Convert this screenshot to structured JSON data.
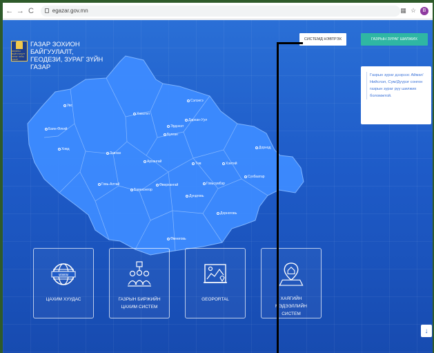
{
  "browser": {
    "back": "←",
    "forward": "→",
    "reload": "C",
    "url": "egazar.gov.mn",
    "profile_initial": "B"
  },
  "header": {
    "org_line1": "ГАЗАР ЗОХИОН БАЙГУУЛАЛТ,",
    "org_line2": "ГЕОДЕЗИ, ЗУРАГ ЗҮЙН ГАЗАР",
    "emblem_text": "ЗОХИОН БАЙГУУЛАЛТ ЗУРАГ ЗҮЙН ГАЗАР",
    "system_login": "СИСТЕМД НЭВТРЭХ",
    "plan_button": "ГАЗРЫН ЗУРАГ ШИЛЖИХ"
  },
  "side_card": {
    "text": "Газрын зураг дээрээс Аймаг/Нийслэл, Сум/Дүүрэг сонгон газрын зураг руу шилжих боломжтой."
  },
  "cities": [
    {
      "name": "Увс"
    },
    {
      "name": "Хөвсгөл"
    },
    {
      "name": "Сэлэнгэ"
    },
    {
      "name": "Баян-Өлгий"
    },
    {
      "name": "Эрдэнэт"
    },
    {
      "name": "Дархан-Уул"
    },
    {
      "name": "Булган"
    },
    {
      "name": "Ховд"
    },
    {
      "name": "Завхан"
    },
    {
      "name": "Архангай"
    },
    {
      "name": "Төв"
    },
    {
      "name": "Хэнтий"
    },
    {
      "name": "Дорнод"
    },
    {
      "name": "Говь-Алтай"
    },
    {
      "name": "Баянхонгор"
    },
    {
      "name": "Өвөрхангай"
    },
    {
      "name": "Сүхбаатар"
    },
    {
      "name": "Дундговь"
    },
    {
      "name": "Говьсүмбэр"
    },
    {
      "name": "Дорноговь"
    },
    {
      "name": "Өмнөговь"
    }
  ],
  "tiles": [
    {
      "label": "ЦАХИМ ХУУДАС",
      "icon": "www-globe-icon"
    },
    {
      "label": "ГАЗРЫН БИРЖИЙН ЦАХИМ СИСТЕМ",
      "icon": "people-exchange-icon"
    },
    {
      "label": "GEOPORTAL",
      "icon": "map-icon"
    },
    {
      "label": "ХАЯГИЙН МЭДЭЭЛЛИЙН СИСТЕМ",
      "icon": "address-pin-icon"
    }
  ],
  "scroll_down": "↓"
}
